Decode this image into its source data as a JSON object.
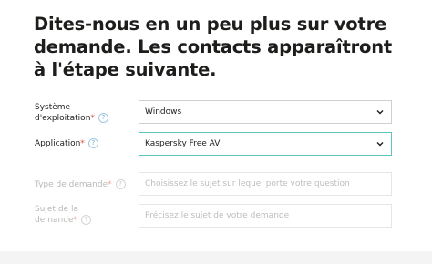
{
  "form": {
    "heading": "Dites-nous en un peu plus sur votre demande. Les contacts apparaîtront à l'étape suivante.",
    "help_glyph": "?",
    "required_marker": "*",
    "fields": [
      {
        "label_line1": "Système",
        "label_line2": "d'exploitation",
        "value": "Windows",
        "state": "enabled"
      },
      {
        "label_line1": "Application",
        "value": "Kaspersky Free AV",
        "state": "focused"
      },
      {
        "label_line1": "Type de demande",
        "placeholder": "Choisissez le sujet sur lequel porte votre question",
        "state": "disabled"
      },
      {
        "label_line1": "Sujet de la",
        "label_line2": "demande",
        "placeholder": "Précisez le sujet de votre demande",
        "state": "disabled"
      }
    ]
  },
  "colors": {
    "text": "#1d1d1b",
    "required": "#e2503c",
    "focus_border": "#5fc4b9",
    "help_icon": "#6fa8cc",
    "disabled_text": "#bdbdbd"
  }
}
